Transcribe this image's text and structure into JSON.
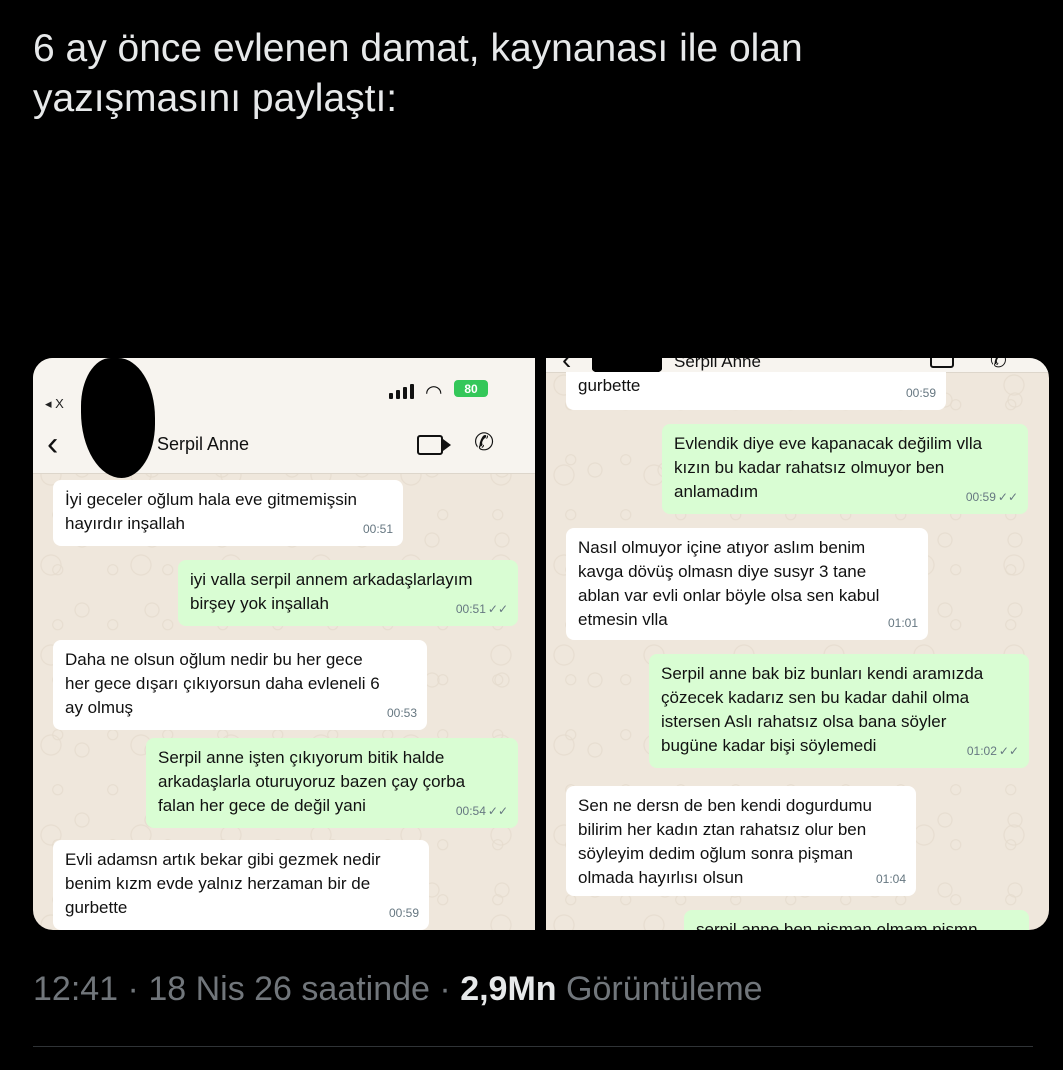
{
  "tweet": {
    "text": "6 ay önce evlenen damat, kaynanası ile olan\nyazışmasını paylaştı:",
    "time": "12:41",
    "date": "18 Nis 26 saatinde",
    "views_count": "2,9Mn",
    "views_label": "Görüntüleme",
    "sep": "·"
  },
  "left_screen": {
    "status": {
      "back_label": "◂ X",
      "battery": "80"
    },
    "contact_name": "Serpil Anne",
    "messages": [
      {
        "dir": "in",
        "text": "İyi geceler oğlum hala eve gitmemişsin\nhayırdır inşallah",
        "time": "00:51"
      },
      {
        "dir": "out",
        "text": "iyi valla serpil annem arkadaşlarlayım\nbirşey yok inşallah",
        "time": "00:51"
      },
      {
        "dir": "in",
        "text": "Daha ne olsun oğlum nedir bu her gece\nher gece dışarı çıkıyorsun daha evleneli 6\nay olmuş",
        "time": "00:53"
      },
      {
        "dir": "out",
        "text": "Serpil anne işten çıkıyorum bitik halde\narkadaşlarla oturuyoruz bazen çay çorba\nfalan her gece de değil yani",
        "time": "00:54"
      },
      {
        "dir": "in",
        "text": "Evli adamsn artık bekar gibi gezmek nedir\nbenim kızm evde yalnız herzaman bir de\ngurbette",
        "time": "00:59"
      }
    ]
  },
  "right_screen": {
    "contact_name": "Serpil Anne",
    "messages": [
      {
        "dir": "in",
        "text": "gurbette",
        "time": "00:59"
      },
      {
        "dir": "out",
        "text": "Evlendik diye eve kapanacak değilim vlla\nkızın bu kadar rahatsız olmuyor ben\nanlamadım",
        "time": "00:59"
      },
      {
        "dir": "in",
        "text": "Nasıl olmuyor içine atıyor aslım benim\nkavga dövüş olmasn diye susyr 3 tane\nablan var evli onlar böyle olsa sen kabul\netmesin vlla",
        "time": "01:01"
      },
      {
        "dir": "out",
        "text": "Serpil anne bak biz bunları kendi aramızda\nçözecek kadarız sen bu kadar dahil olma\nistersen Aslı rahatsız olsa bana söyler\nbugüne kadar bişi söylemedi",
        "time": "01:02"
      },
      {
        "dir": "in",
        "text": "Sen ne dersn de ben kendi dogurdumu\nbilirim  her kadın ztan rahatsız olur ben\nsöyleyim dedim oğlum sonra pişman\nolmada hayırlısı olsun",
        "time": "01:04"
      },
      {
        "dir": "out",
        "text": "serpil anne ben pişman olmam pişmn",
        "time": ""
      }
    ]
  },
  "ticks": "✓✓"
}
